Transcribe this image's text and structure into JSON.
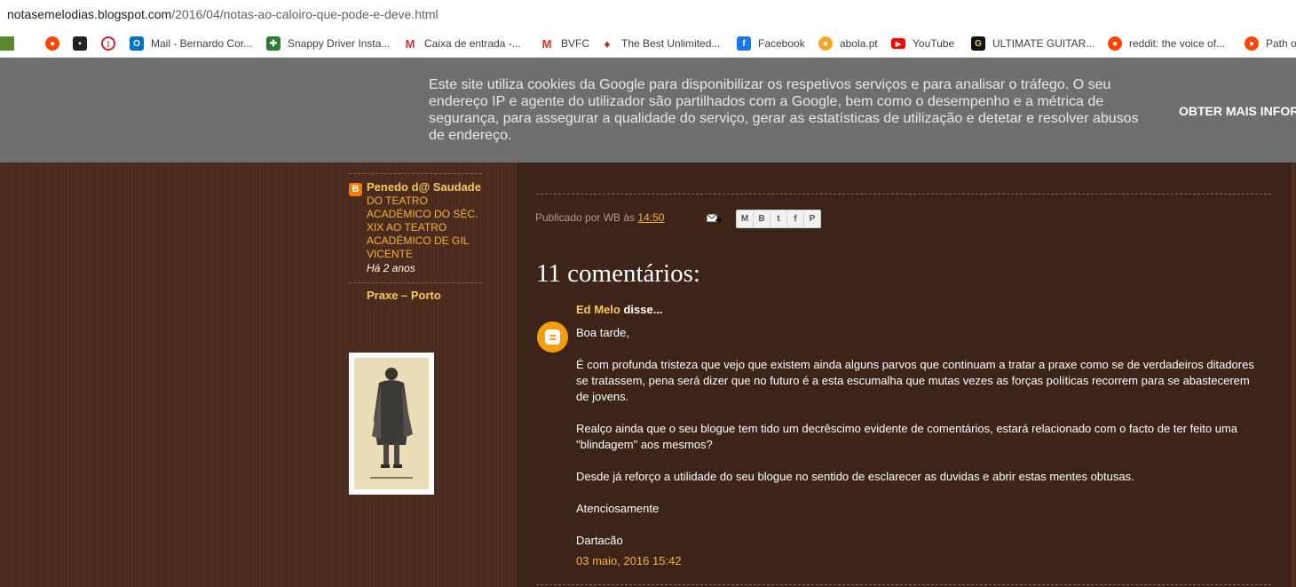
{
  "browser": {
    "url_host": "notasemelodias.blogspot.com",
    "url_path": "/2016/04/notas-ao-caloiro-que-pode-e-deve.html"
  },
  "bookmarks": [
    {
      "icon": "minecraft-icon",
      "label": "",
      "color": "#5b8731"
    },
    {
      "icon": "reddit-icon",
      "label": "",
      "color": "#ff4500"
    },
    {
      "icon": "ghost-icon",
      "label": "",
      "color": "#222222"
    },
    {
      "icon": "circle-icon",
      "label": "",
      "color": "#c62828"
    },
    {
      "icon": "outlook-icon",
      "label": "Mail - Bernardo Cor...",
      "color": "#0072c6"
    },
    {
      "icon": "puzzle-icon",
      "label": "Snappy Driver Insta...",
      "color": "#2e7d32"
    },
    {
      "icon": "gmail-icon",
      "label": "Caixa de entrada -...",
      "color": "#d93025"
    },
    {
      "icon": "gmail-icon",
      "label": "BVFC",
      "color": "#d93025"
    },
    {
      "icon": "flame-icon",
      "label": "The Best Unlimited...",
      "color": "#c62828"
    },
    {
      "icon": "facebook-icon",
      "label": "Facebook",
      "color": "#1877f2"
    },
    {
      "icon": "abola-icon",
      "label": "abola.pt",
      "color": "#f5a623"
    },
    {
      "icon": "youtube-icon",
      "label": "YouTube",
      "color": "#ff0000"
    },
    {
      "icon": "guitar-icon",
      "label": "ULTIMATE GUITAR...",
      "color": "#111111"
    },
    {
      "icon": "reddit-icon",
      "label": "reddit: the voice of...",
      "color": "#ff4500"
    },
    {
      "icon": "reddit-icon",
      "label": "Path o",
      "color": "#ff4500"
    }
  ],
  "cookie_banner": {
    "message": "Este site utiliza cookies da Google para disponibilizar os respetivos serviços e para analisar o tráfego. O seu endereço IP e agente do utilizador são partilhados com a Google, bem como o desempenho e a métrica de segurança, para assegurar a qualidade do serviço, gerar as estatísticas de utilização e detetar e resolver abusos de endereço.",
    "more_label": "OBTER MAIS INFOR"
  },
  "sidebar": {
    "post_title": "Penedo d@ Saudade",
    "post_text": "DO TEATRO ACADÉMICO DO SÉC. XIX AO TEATRO ACADÉMICO DE GIL VICENTE",
    "post_ago": "Há 2 anos",
    "link": "Praxe – Porto"
  },
  "post": {
    "byline_prefix": "Publicado por WB às",
    "time": "14:50",
    "share_buttons": [
      "M",
      "B",
      "t",
      "f",
      "P"
    ]
  },
  "comments": {
    "heading": "11 comentários:",
    "items": [
      {
        "author": "Ed Melo",
        "said": "disse...",
        "paragraphs": [
          "Boa tarde,",
          "É com profunda tristeza que vejo que existem ainda alguns parvos que continuam a tratar a praxe como se de verdadeiros ditadores se tratassem, pena será dizer que no futuro é a esta escumalha que mutas vezes as forças políticas recorrem para se abastecerem de jovens.",
          "Realço ainda que o seu blogue tem tido um decrêscimo evidente de comentários, estará relacionado com o facto de ter feito uma \"blindagem\" aos mesmos?",
          "Desde já reforço a utilidade do seu blogue no sentido de esclarecer as duvidas e abrir estas mentes obtusas.",
          "Atenciosamente",
          "Dartacão"
        ],
        "date": "03 maio, 2016 15:42"
      }
    ]
  }
}
